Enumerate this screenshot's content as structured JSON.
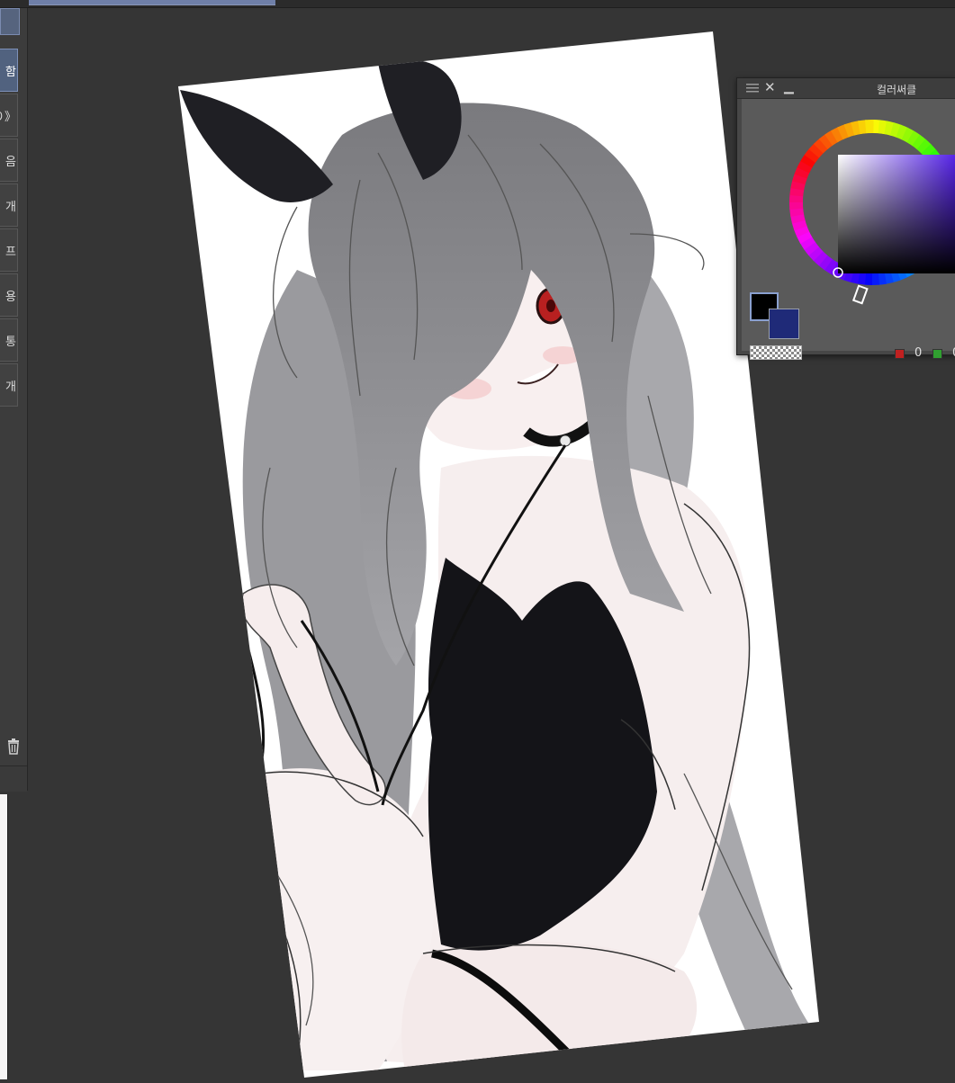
{
  "sidebar": {
    "items": [
      {
        "label": "함"
      },
      {
        "label": "り》"
      },
      {
        "label": "음"
      },
      {
        "label": "개"
      },
      {
        "label": "프"
      },
      {
        "label": "용"
      },
      {
        "label": "통"
      },
      {
        "label": "개"
      }
    ]
  },
  "color_panel": {
    "title": "컬러써클",
    "main_color": "#000000",
    "sub_color": "#1f2a78",
    "r_value": "0",
    "g_value": "0"
  },
  "icons": [
    "menu-icon",
    "close-icon",
    "minimize-icon",
    "trash-icon"
  ]
}
